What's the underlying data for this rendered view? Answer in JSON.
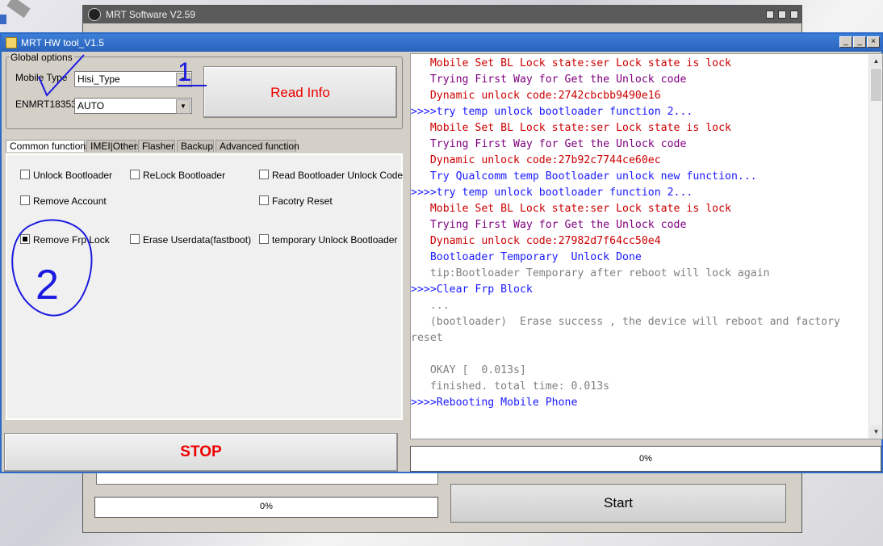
{
  "bg_window": {
    "title": "MRT Software V2.59",
    "progress_label": "0%",
    "start_label": "Start"
  },
  "window": {
    "title": "MRT HW tool_V1.5",
    "btn_minimize": "_",
    "btn_maximize": "_",
    "btn_close": "×"
  },
  "global_options": {
    "legend": "Global options",
    "mobile_type_label": "Mobile Type",
    "mobile_type_value": "Hisi_Type",
    "enmrt_label": "ENMRT18353",
    "enmrt_value": "AUTO"
  },
  "read_info_label": "Read Info",
  "tabs": [
    "Common functions",
    "IMEI|Others",
    "Flasher",
    "Backup",
    "Advanced function"
  ],
  "options": [
    {
      "label": "Unlock Bootloader",
      "checked": false
    },
    {
      "label": "ReLock Bootloader",
      "checked": false
    },
    {
      "label": "Read Bootloader Unlock Code",
      "checked": false
    },
    {
      "label": "Remove Account",
      "checked": false
    },
    {
      "label": "Facotry Reset",
      "checked": false
    },
    {
      "label": "Remove Frp Lock",
      "checked": true
    },
    {
      "label": "Erase Userdata(fastboot)",
      "checked": false
    },
    {
      "label": "temporary Unlock Bootloader",
      "checked": false
    }
  ],
  "stop_label": "STOP",
  "progress_label": "0%",
  "annotations": {
    "mark1": "1",
    "mark2": "2"
  },
  "log_colors": {
    "red": "#cc0000",
    "purple": "#800080",
    "blue": "#1a1aff",
    "gray": "#808080"
  },
  "log": [
    {
      "text": "   Mobile Set BL Lock state:ser Lock state is lock",
      "color": "red"
    },
    {
      "text": "   Trying First Way for Get the Unlock code",
      "color": "purple"
    },
    {
      "text": "   Dynamic unlock code:2742cbcbb9490e16",
      "color": "red"
    },
    {
      "text": ">>>>try temp unlock bootloader function 2...",
      "color": "blue"
    },
    {
      "text": "   Mobile Set BL Lock state:ser Lock state is lock",
      "color": "red"
    },
    {
      "text": "   Trying First Way for Get the Unlock code",
      "color": "purple"
    },
    {
      "text": "   Dynamic unlock code:27b92c7744ce60ec",
      "color": "red"
    },
    {
      "text": "   Try Qualcomm temp Bootloader unlock new function...",
      "color": "blue"
    },
    {
      "text": ">>>>try temp unlock bootloader function 2...",
      "color": "blue"
    },
    {
      "text": "   Mobile Set BL Lock state:ser Lock state is lock",
      "color": "red"
    },
    {
      "text": "   Trying First Way for Get the Unlock code",
      "color": "purple"
    },
    {
      "text": "   Dynamic unlock code:27982d7f64cc50e4",
      "color": "red"
    },
    {
      "text": "   Bootloader Temporary  Unlock Done",
      "color": "blue"
    },
    {
      "text": "   tip:Bootloader Temporary after reboot will lock again",
      "color": "gray"
    },
    {
      "text": ">>>>Clear Frp Block",
      "color": "blue"
    },
    {
      "text": "   ...",
      "color": "gray"
    },
    {
      "text": "   (bootloader)  Erase success , the device will reboot and factory",
      "color": "gray"
    },
    {
      "text": "reset",
      "color": "gray"
    },
    {
      "text": "",
      "color": "gray"
    },
    {
      "text": "   OKAY [  0.013s]",
      "color": "gray"
    },
    {
      "text": "   finished. total time: 0.013s",
      "color": "gray"
    },
    {
      "text": ">>>>Rebooting Mobile Phone",
      "color": "blue"
    }
  ]
}
